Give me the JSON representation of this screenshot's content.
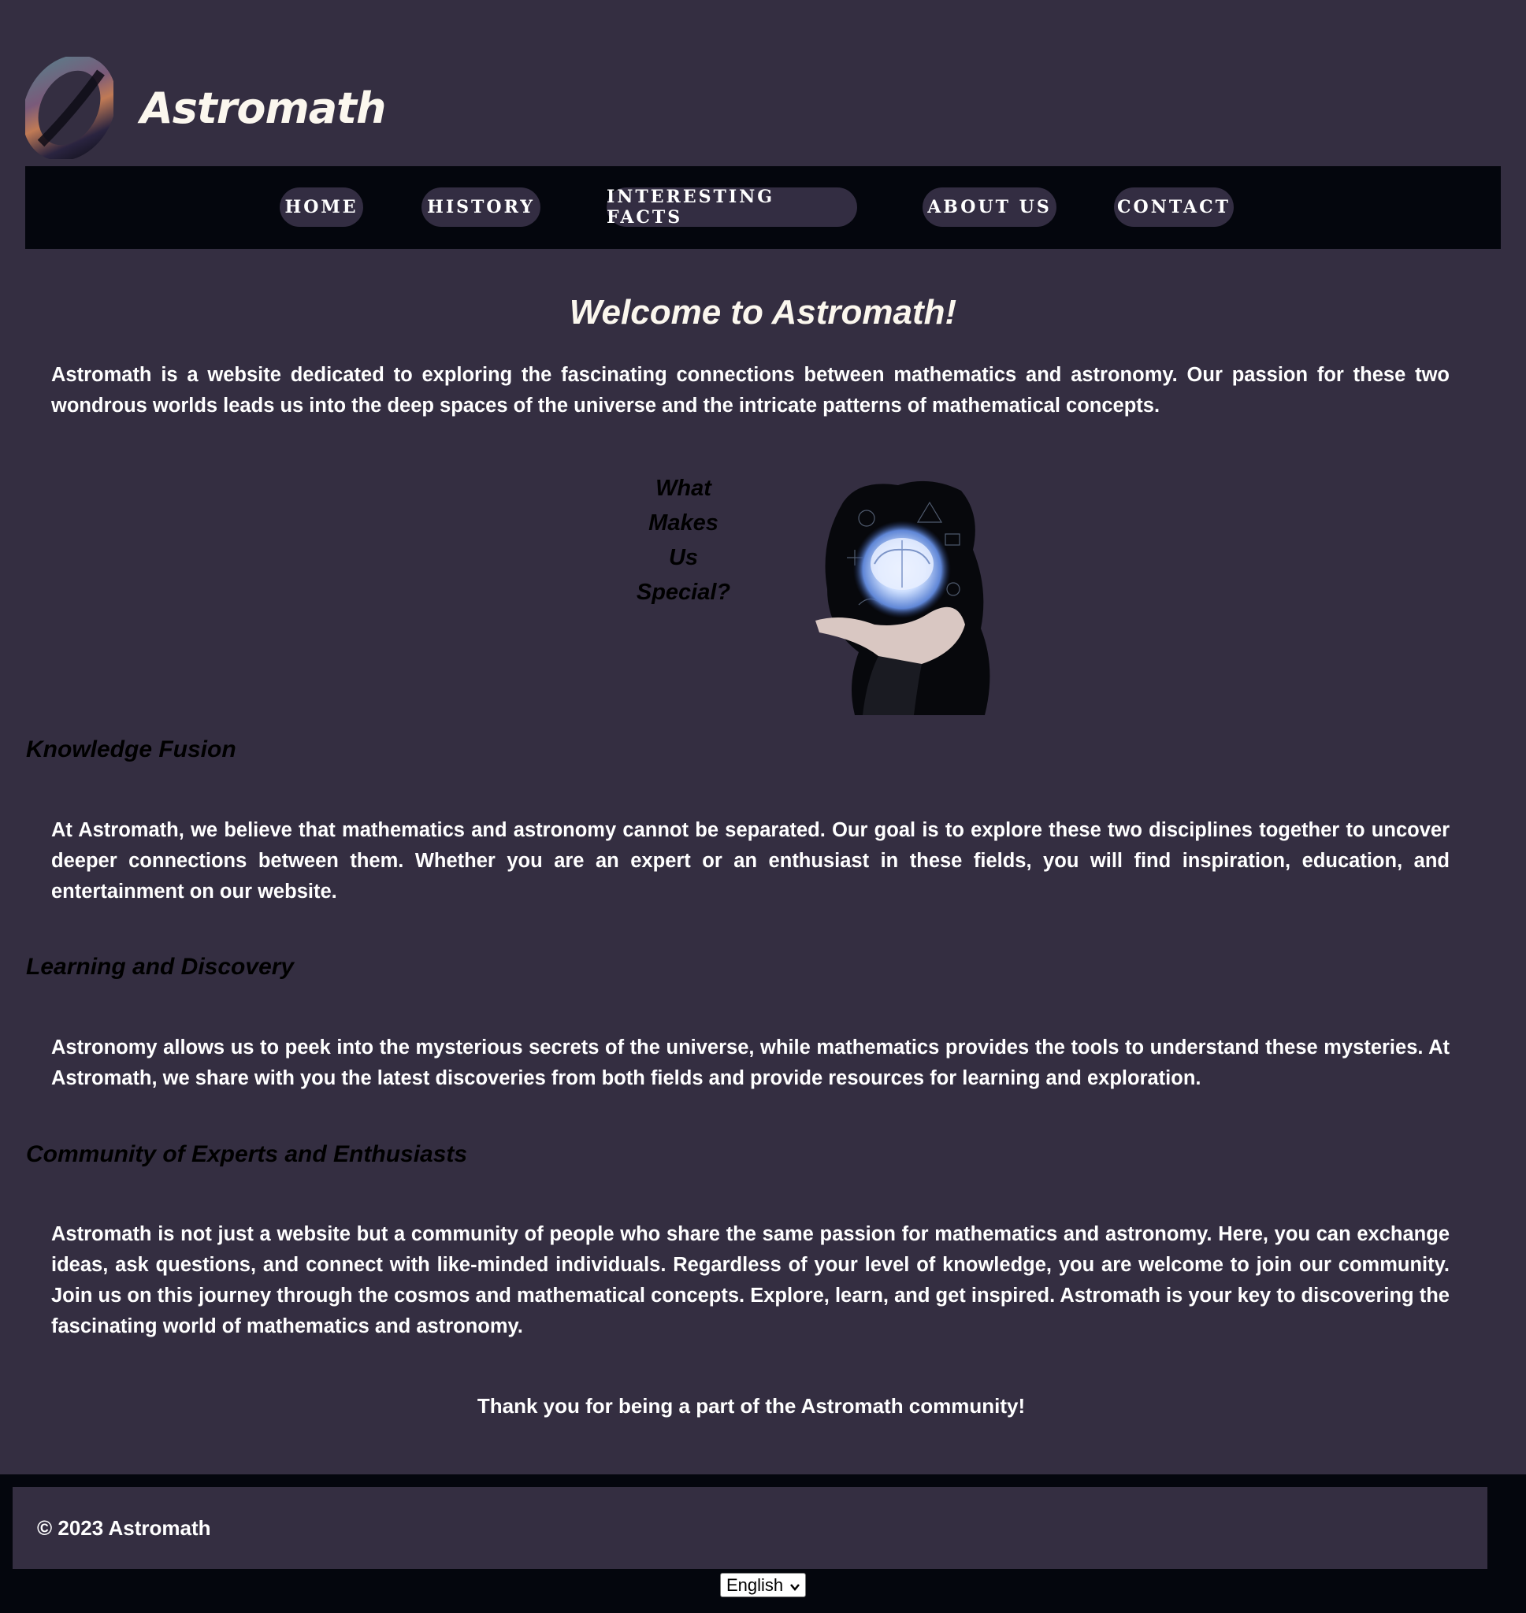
{
  "header": {
    "logo_name": "astromath-logo",
    "title": "Astromath"
  },
  "nav": {
    "items": [
      {
        "label": "HOME"
      },
      {
        "label": "HISTORY"
      },
      {
        "label": "INTERESTING FACTS"
      },
      {
        "label": "ABOUT US"
      },
      {
        "label": "CONTACT"
      }
    ]
  },
  "main": {
    "title": "Welcome to Astromath!",
    "intro": "Astromath is a website dedicated to exploring the fascinating connections between mathematics and astronomy. Our passion for these two wondrous worlds leads us into the deep spaces of the universe and the intricate patterns of mathematical concepts.",
    "special_lines": [
      "What",
      "Makes",
      "Us",
      "Special?"
    ],
    "image_name": "hand-holding-glowing-brain-image",
    "sections": [
      {
        "heading": "Knowledge Fusion",
        "text": "At Astromath, we believe that mathematics and astronomy cannot be separated. Our goal is to explore these two disciplines together to uncover deeper connections between them. Whether you are an expert or an enthusiast in these fields, you will find inspiration, education, and entertainment on our website."
      },
      {
        "heading": "Learning and Discovery",
        "text": "Astronomy allows us to peek into the mysterious secrets of the universe, while mathematics provides the tools to understand these mysteries. At Astromath, we share with you the latest discoveries from both fields and provide resources for learning and exploration."
      },
      {
        "heading": "Community of Experts and Enthusiasts",
        "text": "Astromath is not just a website but a community of people who share the same passion for mathematics and astronomy. Here, you can exchange ideas, ask questions, and connect with like-minded individuals. Regardless of your level of knowledge, you are welcome to join our community. Join us on this journey through the cosmos and mathematical concepts. Explore, learn, and get inspired. Astromath is your key to discovering the fascinating world of mathematics and astronomy."
      }
    ],
    "thanks": "Thank you for being a part of the Astromath community!"
  },
  "footer": {
    "copyright": "© 2023 Astromath",
    "language_selected": "English"
  },
  "colors": {
    "page_bg": "#342e41",
    "nav_bg": "#04060d",
    "title_text": "#fbf7ee",
    "heading_text": "#000000"
  }
}
